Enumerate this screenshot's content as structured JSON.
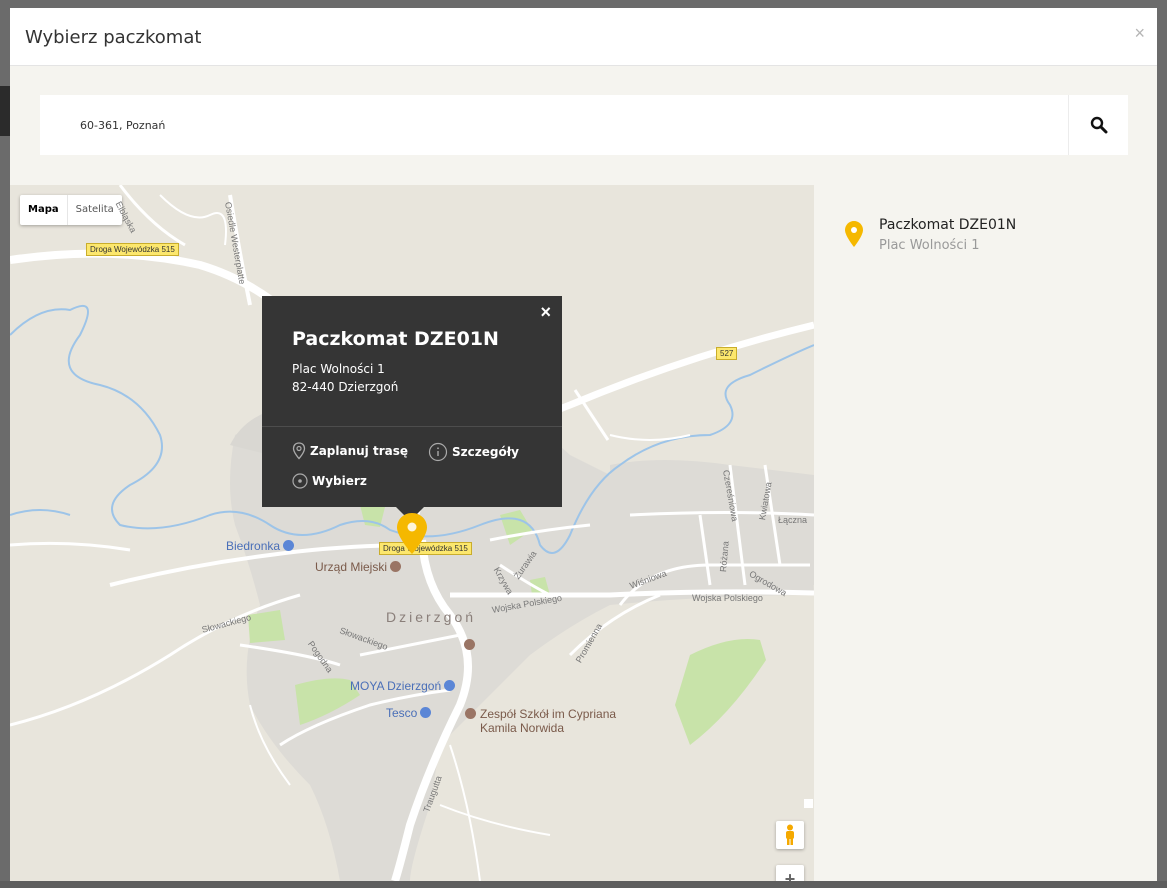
{
  "modal": {
    "title": "Wybierz paczkomat",
    "close_label": "×"
  },
  "search": {
    "value": "60-361, Poznań",
    "icon": "search-icon"
  },
  "map": {
    "type_controls": [
      "Mapa",
      "Satelita"
    ],
    "active_type": "Mapa",
    "road_labels": [
      "Droga Wojewódzka 515",
      "527",
      "Droga Wojewódzka 515"
    ],
    "streets": {
      "elblaska": "Elbląska",
      "westerplatte": "Osiedle Westerplatte",
      "czeresniowa": "Czereśniowa",
      "kwiatowa": "Kwiatowa",
      "laczna": "Łączna",
      "rozana": "Różana",
      "wisniowa": "Wiśniowa",
      "ogrodowa": "Ogrodowa",
      "wojska_polskiego_1": "Wojska Polskiego",
      "wojska_polskiego_2": "Wojska Polskiego",
      "zurawia": "Żurawia",
      "krzywa": "Krzywa",
      "slowackiego_1": "Słowackiego",
      "slowackiego_2": "Słowackiego",
      "pogodna": "Pogodna",
      "promienna": "Promienna",
      "traugutta": "Traugutta"
    },
    "town": "Dzierzgoń",
    "pois": {
      "biedronka": "Biedronka",
      "urzad": "Urząd Miejski",
      "moya": "MOYA Dzierzgoń",
      "tesco": "Tesco",
      "school_line1": "Zespół Szkół im Cypriana",
      "school_line2": "Kamila Norwida"
    },
    "infowindow": {
      "title": "Paczkomat DZE01N",
      "address_line1": "Plac Wolności 1",
      "address_line2": "82-440 Dzierzgoń",
      "close_label": "×",
      "actions": {
        "route": "Zaplanuj trasę",
        "details": "Szczegóły",
        "select": "Wybierz"
      }
    },
    "zoom_in_label": "+"
  },
  "sidebar": {
    "items": [
      {
        "name": "Paczkomat DZE01N",
        "address": "Plac Wolności 1"
      }
    ]
  },
  "colors": {
    "marker": "#f5b800",
    "infowindow_bg": "#353535",
    "road_label": "#fce76d",
    "park": "#c8e3a9",
    "water": "#9dc4e8"
  }
}
